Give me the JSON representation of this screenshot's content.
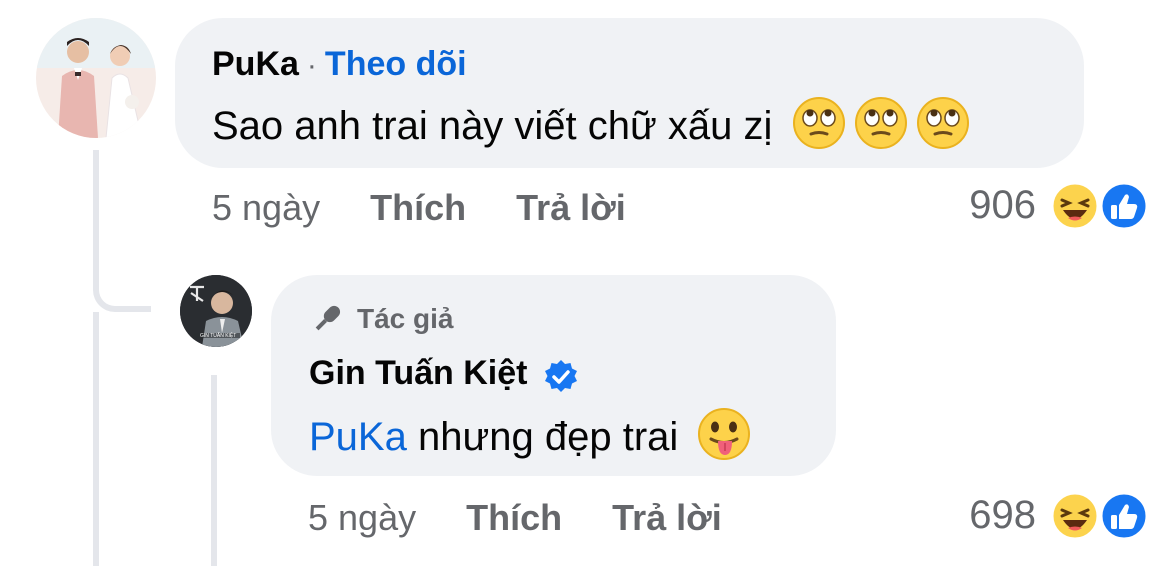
{
  "comment": {
    "author": "PuKa",
    "separator": "·",
    "follow_label": "Theo dõi",
    "text": "Sao anh trai này viết chữ xấu zị",
    "emojis": [
      "face-with-rolling-eyes-icon",
      "face-with-rolling-eyes-icon",
      "face-with-rolling-eyes-icon"
    ],
    "time": "5 ngày",
    "like_label": "Thích",
    "reply_label": "Trả lời",
    "reaction_count": "906",
    "reactions": [
      "haha-icon",
      "like-icon"
    ]
  },
  "reply": {
    "author_tag": "Tác giả",
    "author": "Gin Tuấn Kiệt",
    "verified": true,
    "mention": "PuKa",
    "text": " nhưng đẹp trai",
    "emoji": "face-with-tongue-icon",
    "time": "5 ngày",
    "like_label": "Thích",
    "reply_label": "Trả lời",
    "reaction_count": "698",
    "reactions": [
      "haha-icon",
      "like-icon"
    ]
  },
  "colors": {
    "bubble": "#f0f2f5",
    "link": "#0a66d8",
    "meta": "#65676b",
    "like_blue": "#1877f2",
    "thread_line": "#e4e6eb"
  }
}
